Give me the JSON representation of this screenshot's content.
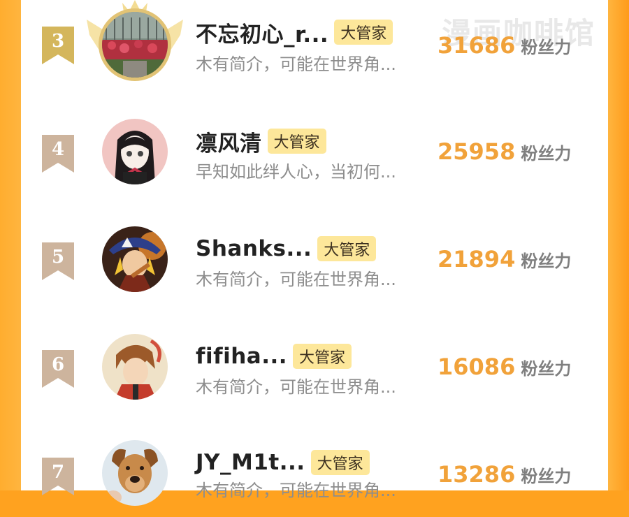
{
  "watermark": "漫画咖啡馆",
  "ranking": [
    {
      "rank": "3",
      "name": "不忘初心_r...",
      "tag": "大管家",
      "bio": "木有简介，可能在世界角...",
      "fans": "31686",
      "fans_label": "粉丝力",
      "badge_color": "#d4b65c",
      "avatar": "garden-photo"
    },
    {
      "rank": "4",
      "name": "凛风清",
      "tag": "大管家",
      "bio": "早知如此绊人心，当初何...",
      "fans": "25958",
      "fans_label": "粉丝力",
      "badge_color": "#cdb49d",
      "avatar": "anime-girl"
    },
    {
      "rank": "5",
      "name": "Shanks...",
      "tag": "大管家",
      "bio": "木有简介，可能在世界角...",
      "fans": "21894",
      "fans_label": "粉丝力",
      "badge_color": "#cdb49d",
      "avatar": "anime-pirate"
    },
    {
      "rank": "6",
      "name": "fifiha...",
      "tag": "大管家",
      "bio": "木有简介，可能在世界角...",
      "fans": "16086",
      "fans_label": "粉丝力",
      "badge_color": "#cdb49d",
      "avatar": "anime-boy"
    },
    {
      "rank": "7",
      "name": "JY_M1t...",
      "tag": "大管家",
      "bio": "木有简介，可能在世界角...",
      "fans": "13286",
      "fans_label": "粉丝力",
      "badge_color": "#cdb49d",
      "avatar": "dog-photo"
    }
  ]
}
